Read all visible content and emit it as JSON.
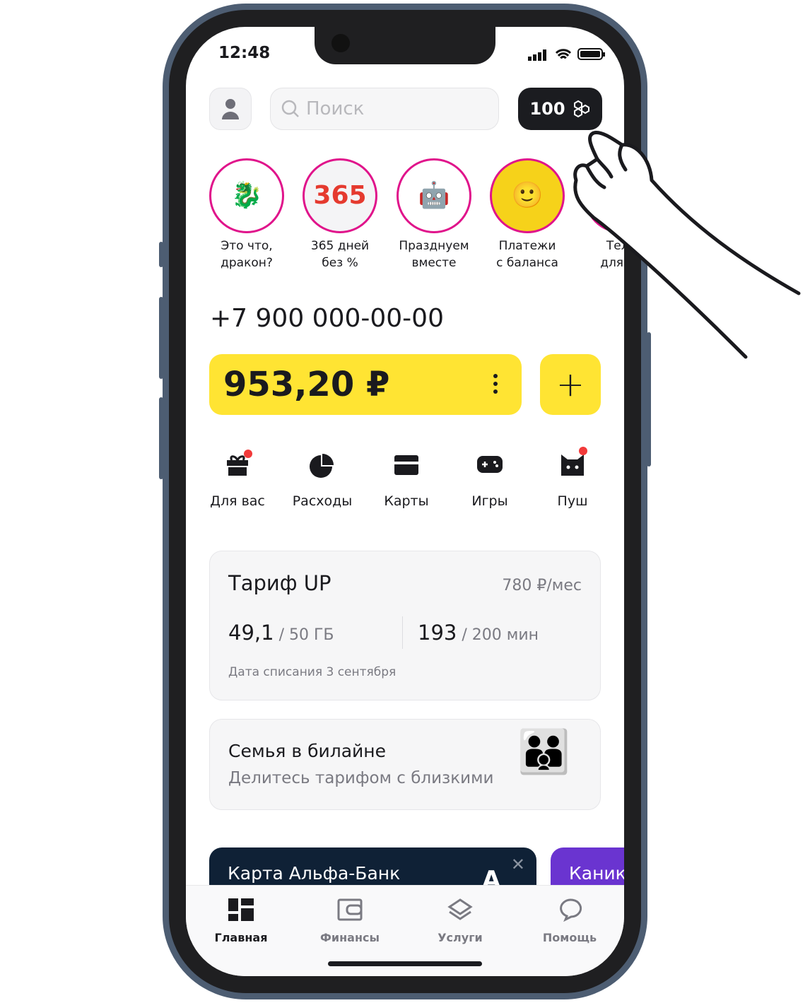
{
  "status": {
    "time": "12:48"
  },
  "header": {
    "search_placeholder": "Поиск",
    "points": "100"
  },
  "stories": [
    {
      "label1": "Это что,",
      "label2": "дракон?"
    },
    {
      "label1": "365 дней",
      "label2": "без %",
      "image_text": "365"
    },
    {
      "label1": "Празднуем",
      "label2": "вместе"
    },
    {
      "label1": "Платежи",
      "label2": "с баланса"
    },
    {
      "label1": "Теле",
      "label2": "для бл"
    }
  ],
  "account": {
    "phone": "+7 900 000-00-00",
    "balance": "953,20 ₽"
  },
  "quick_actions": [
    {
      "label": "Для вас",
      "badge": true
    },
    {
      "label": "Расходы"
    },
    {
      "label": "Карты"
    },
    {
      "label": "Игры"
    },
    {
      "label": "Пуш",
      "badge": true
    }
  ],
  "tariff": {
    "title": "Тариф UP",
    "price": "780 ₽/мес",
    "data_used": "49,1",
    "data_total": "/ 50 ГБ",
    "min_used": "193",
    "min_total": "/ 200 мин",
    "charge_date": "Дата списания 3 сентября"
  },
  "family": {
    "title": "Семья в билайне",
    "subtitle": "Делитесь тарифом с близкими"
  },
  "promos": [
    {
      "title": "Карта Альфа-Банк",
      "logo": "A"
    },
    {
      "title": "Каник"
    }
  ],
  "tabbar": [
    {
      "label": "Главная",
      "active": true
    },
    {
      "label": "Финансы"
    },
    {
      "label": "Услуги"
    },
    {
      "label": "Помощь"
    }
  ],
  "colors": {
    "accent": "#ffe433",
    "story_ring": "#e0148b",
    "promo_dark": "#0f2136",
    "promo_purple": "#6a34d0"
  }
}
